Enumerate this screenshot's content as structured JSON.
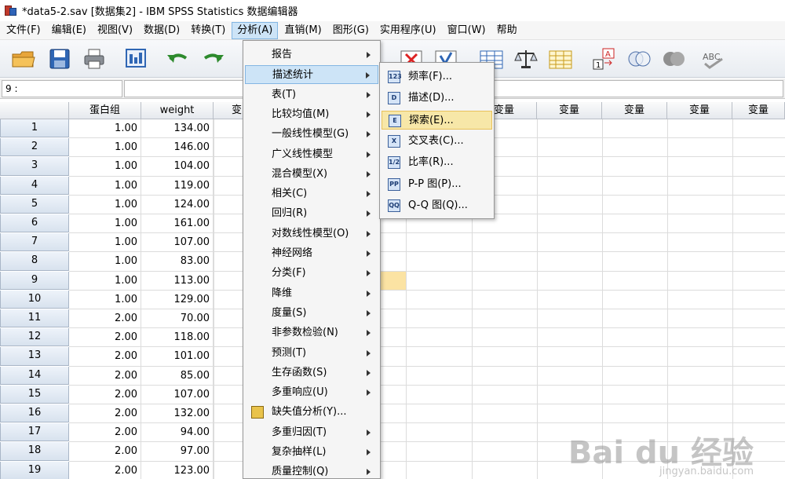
{
  "window": {
    "title": "*data5-2.sav [数据集2] - IBM SPSS Statistics 数据编辑器"
  },
  "menubar": {
    "items": [
      "文件(F)",
      "编辑(E)",
      "视图(V)",
      "数据(D)",
      "转换(T)",
      "分析(A)",
      "直销(M)",
      "图形(G)",
      "实用程序(U)",
      "窗口(W)",
      "帮助"
    ],
    "active": "分析(A)"
  },
  "editbar": {
    "cell_ref": "9 :"
  },
  "grid": {
    "columns": [
      "蛋白组",
      "weight",
      "变",
      "变量",
      "变量",
      "变量",
      "变量",
      "变量"
    ],
    "rows": [
      {
        "n": "1",
        "group": "1.00",
        "weight": "134.00"
      },
      {
        "n": "2",
        "group": "1.00",
        "weight": "146.00"
      },
      {
        "n": "3",
        "group": "1.00",
        "weight": "104.00"
      },
      {
        "n": "4",
        "group": "1.00",
        "weight": "119.00"
      },
      {
        "n": "5",
        "group": "1.00",
        "weight": "124.00"
      },
      {
        "n": "6",
        "group": "1.00",
        "weight": "161.00"
      },
      {
        "n": "7",
        "group": "1.00",
        "weight": "107.00"
      },
      {
        "n": "8",
        "group": "1.00",
        "weight": "83.00"
      },
      {
        "n": "9",
        "group": "1.00",
        "weight": "113.00"
      },
      {
        "n": "10",
        "group": "1.00",
        "weight": "129.00"
      },
      {
        "n": "11",
        "group": "2.00",
        "weight": "70.00"
      },
      {
        "n": "12",
        "group": "2.00",
        "weight": "118.00"
      },
      {
        "n": "13",
        "group": "2.00",
        "weight": "101.00"
      },
      {
        "n": "14",
        "group": "2.00",
        "weight": "85.00"
      },
      {
        "n": "15",
        "group": "2.00",
        "weight": "107.00"
      },
      {
        "n": "16",
        "group": "2.00",
        "weight": "132.00"
      },
      {
        "n": "17",
        "group": "2.00",
        "weight": "94.00"
      },
      {
        "n": "18",
        "group": "2.00",
        "weight": "97.00"
      },
      {
        "n": "19",
        "group": "2.00",
        "weight": "123.00"
      }
    ]
  },
  "analyze_menu": {
    "items": [
      {
        "label": "报告",
        "sub": true
      },
      {
        "label": "描述统计",
        "sub": true,
        "active": true
      },
      {
        "label": "表(T)",
        "sub": true
      },
      {
        "label": "比较均值(M)",
        "sub": true
      },
      {
        "label": "一般线性模型(G)",
        "sub": true
      },
      {
        "label": "广义线性模型",
        "sub": true
      },
      {
        "label": "混合模型(X)",
        "sub": true
      },
      {
        "label": "相关(C)",
        "sub": true
      },
      {
        "label": "回归(R)",
        "sub": true
      },
      {
        "label": "对数线性模型(O)",
        "sub": true
      },
      {
        "label": "神经网络",
        "sub": true
      },
      {
        "label": "分类(F)",
        "sub": true
      },
      {
        "label": "降维",
        "sub": true
      },
      {
        "label": "度量(S)",
        "sub": true
      },
      {
        "label": "非参数检验(N)",
        "sub": true
      },
      {
        "label": "预测(T)",
        "sub": true
      },
      {
        "label": "生存函数(S)",
        "sub": true
      },
      {
        "label": "多重响应(U)",
        "sub": true
      },
      {
        "label": "缺失值分析(Y)...",
        "sub": false,
        "icon": true
      },
      {
        "label": "多重归因(T)",
        "sub": true
      },
      {
        "label": "复杂抽样(L)",
        "sub": true
      },
      {
        "label": "质量控制(Q)",
        "sub": true
      }
    ]
  },
  "descriptive_submenu": {
    "items": [
      {
        "label": "频率(F)...",
        "icon": "123"
      },
      {
        "label": "描述(D)...",
        "icon": "D"
      },
      {
        "label": "探索(E)...",
        "icon": "E",
        "active": true
      },
      {
        "label": "交叉表(C)...",
        "icon": "X"
      },
      {
        "label": "比率(R)...",
        "icon": "1/2"
      },
      {
        "label": "P-P 图(P)...",
        "icon": "PP"
      },
      {
        "label": "Q-Q 图(Q)...",
        "icon": "QQ"
      }
    ]
  },
  "watermark": {
    "text": "Bai du 经验",
    "sub": "jingyan.baidu.com"
  }
}
